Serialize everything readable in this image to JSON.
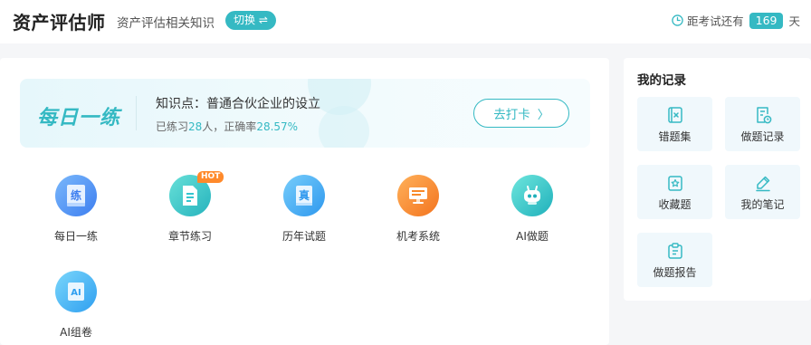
{
  "header": {
    "app_title": "资产评估师",
    "subtitle": "资产评估相关知识",
    "switch_label": "切换 ⇌",
    "countdown_prefix": "距考试还有",
    "countdown_days": "169",
    "countdown_unit": "天"
  },
  "banner": {
    "title": "每日一练",
    "knowledge_point": "知识点：普通合伙企业的设立",
    "stats_prefix": "已练习",
    "practiced_count": "28",
    "stats_middle": "人，正确率",
    "accuracy": "28.57%",
    "checkin_label": "去打卡"
  },
  "features": [
    {
      "label": "每日一练",
      "icon": "practice-icon"
    },
    {
      "label": "章节练习",
      "icon": "chapter-icon",
      "badge": "HOT"
    },
    {
      "label": "历年试题",
      "icon": "past-exam-icon"
    },
    {
      "label": "机考系统",
      "icon": "computer-exam-icon"
    },
    {
      "label": "AI做题",
      "icon": "ai-robot-icon"
    },
    {
      "label": "AI组卷",
      "icon": "ai-paper-icon"
    }
  ],
  "icon_glyphs": {
    "practice": "练",
    "past_exam": "真",
    "ai_paper": "AI"
  },
  "records": {
    "title": "我的记录",
    "items": [
      {
        "label": "错题集",
        "icon": "wrong-book-icon"
      },
      {
        "label": "做题记录",
        "icon": "history-icon"
      },
      {
        "label": "收藏题",
        "icon": "favorite-icon"
      },
      {
        "label": "我的笔记",
        "icon": "note-icon"
      },
      {
        "label": "做题报告",
        "icon": "report-icon"
      }
    ]
  },
  "colors": {
    "accent": "#35b9c3",
    "hot": "#ff8a2b",
    "icon_blue": "#3d8ef0",
    "icon_cyan": "#34c6cf",
    "icon_orange": "#f98a2a"
  }
}
